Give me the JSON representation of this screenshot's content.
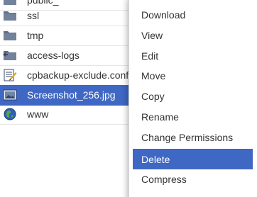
{
  "file_list": {
    "rows": [
      {
        "name": "public_",
        "icon": "folder-icon",
        "selected": false
      },
      {
        "name": "ssl",
        "icon": "folder-icon",
        "selected": false
      },
      {
        "name": "tmp",
        "icon": "folder-icon",
        "selected": false
      },
      {
        "name": "access-logs",
        "icon": "folder-shortcut-icon",
        "selected": false
      },
      {
        "name": "cpbackup-exclude.conf",
        "icon": "config-file-icon",
        "selected": false
      },
      {
        "name": "Screenshot_256.jpg",
        "icon": "image-file-icon",
        "selected": true
      },
      {
        "name": "www",
        "icon": "globe-icon",
        "selected": false
      }
    ]
  },
  "context_menu": {
    "items": [
      {
        "label": "Download"
      },
      {
        "label": "View"
      },
      {
        "label": "Edit"
      },
      {
        "label": "Move"
      },
      {
        "label": "Copy"
      },
      {
        "label": "Rename"
      },
      {
        "label": "Change Permissions"
      },
      {
        "label": "Delete",
        "active": true
      },
      {
        "label": "Compress"
      }
    ]
  },
  "colors": {
    "selection": "#3f67c4",
    "folder": "#5f6f86",
    "text": "#333333"
  }
}
